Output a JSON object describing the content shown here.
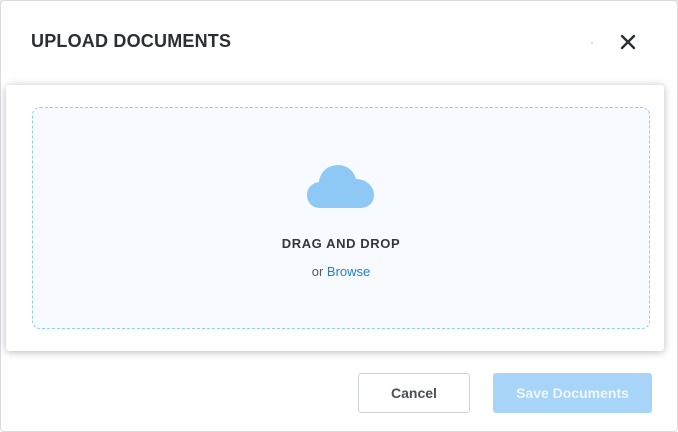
{
  "modal": {
    "title": "UPLOAD DOCUMENTS",
    "close_icon": "close-icon"
  },
  "dropzone": {
    "icon": "cloud-icon",
    "heading": "DRAG AND DROP",
    "or_text": "or",
    "browse_label": "Browse"
  },
  "footer": {
    "cancel_label": "Cancel",
    "save_label": "Save Documents",
    "save_disabled": true
  },
  "colors": {
    "accent": "#1f7fd0",
    "cloud": "#8ec9f5",
    "dropzone_border": "#8fd0f0",
    "save_button_disabled": "#a7d4f7"
  }
}
